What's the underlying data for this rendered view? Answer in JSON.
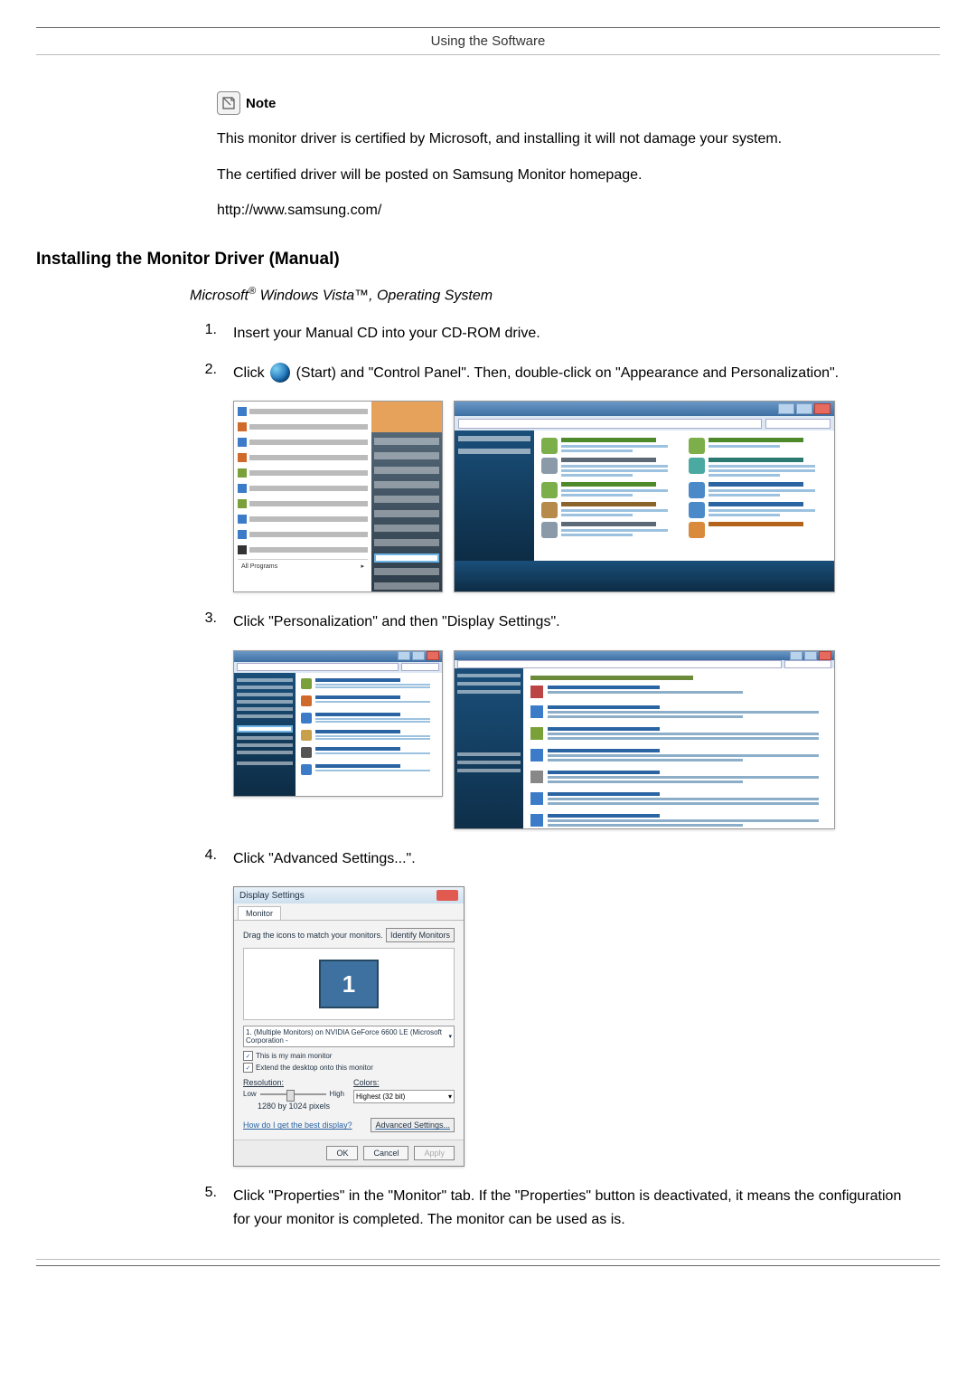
{
  "header": {
    "title": "Using the Software"
  },
  "note": {
    "label": "Note",
    "line1": "This monitor driver is certified by Microsoft, and installing it will not damage your system.",
    "line2": "The certified driver will be posted on Samsung Monitor homepage.",
    "url": "http://www.samsung.com/"
  },
  "section": {
    "heading": "Installing the Monitor Driver (Manual)",
    "subheading_prefix": "Microsoft",
    "subheading_suffix": " Windows Vista™, Operating System"
  },
  "steps": {
    "s1_num": "1.",
    "s1_text": "Insert your Manual CD into your CD-ROM drive.",
    "s2_num": "2.",
    "s2_pre": "Click ",
    "s2_post": "(Start) and \"Control Panel\". Then, double-click on \"Appearance and Personalization\".",
    "s3_num": "3.",
    "s3_text": "Click \"Personalization\" and then \"Display Settings\".",
    "s4_num": "4.",
    "s4_text": "Click \"Advanced Settings...\".",
    "s5_num": "5.",
    "s5_text": "Click \"Properties\" in the \"Monitor\" tab. If the \"Properties\" button is deactivated, it means the configuration for your monitor is completed. The monitor can be used as is."
  },
  "start_menu": {
    "items": [
      "Internet",
      "E-mail",
      "Windows Mail",
      "Welcome Center",
      "Windows Media Player",
      "Windows Photo Gallery",
      "Windows Live Messenger Download",
      "Windows Meeting Space",
      "Windows Anytime Upgrade",
      "Adobe Photoshop CS2",
      "Notepad",
      "Command Prompt"
    ],
    "right_items": [
      "Documents",
      "Pictures",
      "Music",
      "Games",
      "Search",
      "Recent Items",
      "Computer",
      "Network",
      "Connect To",
      "Control Panel",
      "Default Programs",
      "Help and Support"
    ],
    "all_programs": "All Programs"
  },
  "control_panel": {
    "title": "Control Panel",
    "left": [
      "Control Panel Home",
      "Classic View"
    ],
    "categories": [
      {
        "name": "System and Maintenance",
        "sub": "Get started with Windows · Back up your computer"
      },
      {
        "name": "User Accounts",
        "sub": "Add or remove user accounts"
      },
      {
        "name": "Security",
        "sub": "Check for updates · Check this computer's security status · Allow a program through Windows Firewall"
      },
      {
        "name": "Appearance and Personalization",
        "sub": "Change desktop background · Change the color scheme · Adjust screen resolution"
      },
      {
        "name": "Network and Internet",
        "sub": "View network status and tasks · Set up file sharing"
      },
      {
        "name": "Clock, Language, and Region",
        "sub": "Change keyboards or other input methods · Change display language"
      },
      {
        "name": "Hardware and Sound",
        "sub": "Play CDs or other media automatically · Printer · Mouse"
      },
      {
        "name": "Ease of Access",
        "sub": "Let Windows suggest settings · Optimize visual display"
      },
      {
        "name": "Programs",
        "sub": "Uninstall a program · Change startup programs"
      },
      {
        "name": "Additional Options",
        "sub": ""
      }
    ],
    "recent_tasks": "Recent Tasks"
  },
  "appearance_panel": {
    "crumb": "Control Panel ▸ Appearance and Personalization",
    "left": [
      "Control Panel Home",
      "System and Maintenance",
      "Security",
      "Network and Internet",
      "Hardware and Sound",
      "Programs",
      "User Accounts",
      "Appearance and Personalization",
      "Clock, Language, and Region",
      "Ease of Access",
      "Additional Options",
      "Classic View"
    ],
    "items": [
      {
        "name": "Personalization",
        "sub": "Change desktop background · Customize colors · Adjust screen resolution"
      },
      {
        "name": "Taskbar and Start Menu",
        "sub": "Customize the Start menu · Customize icons on the taskbar"
      },
      {
        "name": "Ease of Access Center",
        "sub": "Accommodate low vision · Change screen reader · Turn High Contrast on or off"
      },
      {
        "name": "Folder Options",
        "sub": "Specify single- or double-click to open · Show hidden files and folders"
      },
      {
        "name": "Fonts",
        "sub": "Install or remove a font"
      },
      {
        "name": "Windows Sidebar Properties",
        "sub": "Add gadgets to Sidebar · Choose whether to keep Sidebar on top of other windows"
      }
    ]
  },
  "personalization_panel": {
    "crumb": "Appearance and Personalization ▸ Personalization",
    "left": [
      "Tasks",
      "Change desktop icons",
      "Adjust font size (DPI)"
    ],
    "heading": "Personalize appearance and sounds",
    "items": [
      {
        "name": "Window Color and Appearance",
        "sub": "Fine tune the color and style of your windows."
      },
      {
        "name": "Desktop Background",
        "sub": "Choose from available backgrounds or colors or use one of your own pictures to decorate the desktop."
      },
      {
        "name": "Screen Saver",
        "sub": "Change your screen saver or adjust when it displays. A screen saver is a picture or animation that covers your screen and appears when your computer is idle for a set period of time."
      },
      {
        "name": "Sounds",
        "sub": "Change which sounds are heard when you do everything from getting e-mail to emptying your Recycle Bin."
      },
      {
        "name": "Mouse Pointers",
        "sub": "Pick a different mouse pointer. You can also change how the mouse pointer looks during such activities as clicking and selecting."
      },
      {
        "name": "Theme",
        "sub": "Change the theme. Themes can change a wide range of visual and auditory elements at one time, including the appearance of menus, icons, backgrounds, screen savers, some computer sounds, and mouse pointers."
      },
      {
        "name": "Display Settings",
        "sub": "Adjust your monitor resolution, which changes the view so more or fewer items fit on the screen. You can also control monitor flicker (refresh rate)."
      }
    ]
  },
  "display_settings": {
    "title": "Display Settings",
    "tab": "Monitor",
    "drag_label": "Drag the icons to match your monitors.",
    "identify_btn": "Identify Monitors",
    "monitor_number": "1",
    "select_value": "1. (Multiple Monitors) on NVIDIA GeForce 6600 LE (Microsoft Corporation -",
    "chk1": "This is my main monitor",
    "chk2": "Extend the desktop onto this monitor",
    "res_label": "Resolution:",
    "res_low": "Low",
    "res_high": "High",
    "res_value": "1280 by 1024 pixels",
    "color_label": "Colors:",
    "color_value": "Highest (32 bit)",
    "help_link": "How do I get the best display?",
    "adv_btn": "Advanced Settings...",
    "ok": "OK",
    "cancel": "Cancel",
    "apply": "Apply"
  }
}
